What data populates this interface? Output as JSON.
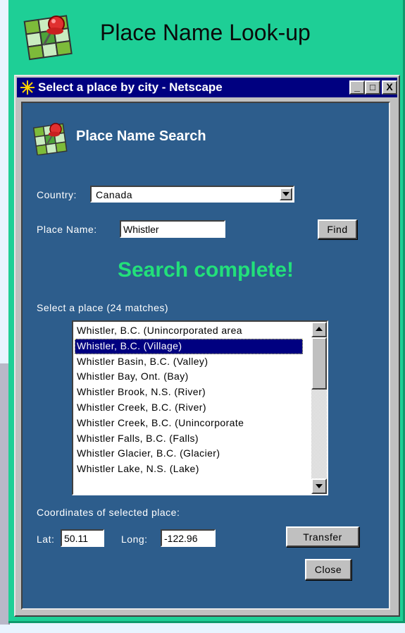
{
  "header": {
    "title": "Place Name Look-up"
  },
  "window": {
    "title": "Select a place by city - Netscape",
    "controls": {
      "minimize": "_",
      "maximize": "□",
      "close": "X"
    }
  },
  "search": {
    "title": "Place Name Search",
    "country_label": "Country:",
    "country_value": "Canada",
    "place_label": "Place Name:",
    "place_value": "Whistler",
    "find_button": "Find",
    "status": "Search complete!",
    "status_color": "#22e07a"
  },
  "results": {
    "label": "Select a place (24 matches)",
    "selected_index": 1,
    "items": [
      "Whistler, B.C. (Unincorporated area",
      "Whistler, B.C. (Village)",
      "Whistler Basin, B.C. (Valley)",
      "Whistler Bay, Ont. (Bay)",
      "Whistler Brook, N.S. (River)",
      "Whistler Creek, B.C. (River)",
      "Whistler Creek, B.C. (Unincorporate",
      "Whistler Falls, B.C. (Falls)",
      "Whistler Glacier, B.C. (Glacier)",
      "Whistler Lake, N.S. (Lake)"
    ]
  },
  "coords": {
    "label": "Coordinates of selected place:",
    "lat_label": "Lat:",
    "lat_value": "50.11",
    "long_label": "Long:",
    "long_value": "-122.96",
    "transfer_button": "Transfer",
    "close_button": "Close"
  },
  "colors": {
    "panel": "#1ecf96",
    "content": "#2d5d8c",
    "titlebar": "#000080"
  }
}
